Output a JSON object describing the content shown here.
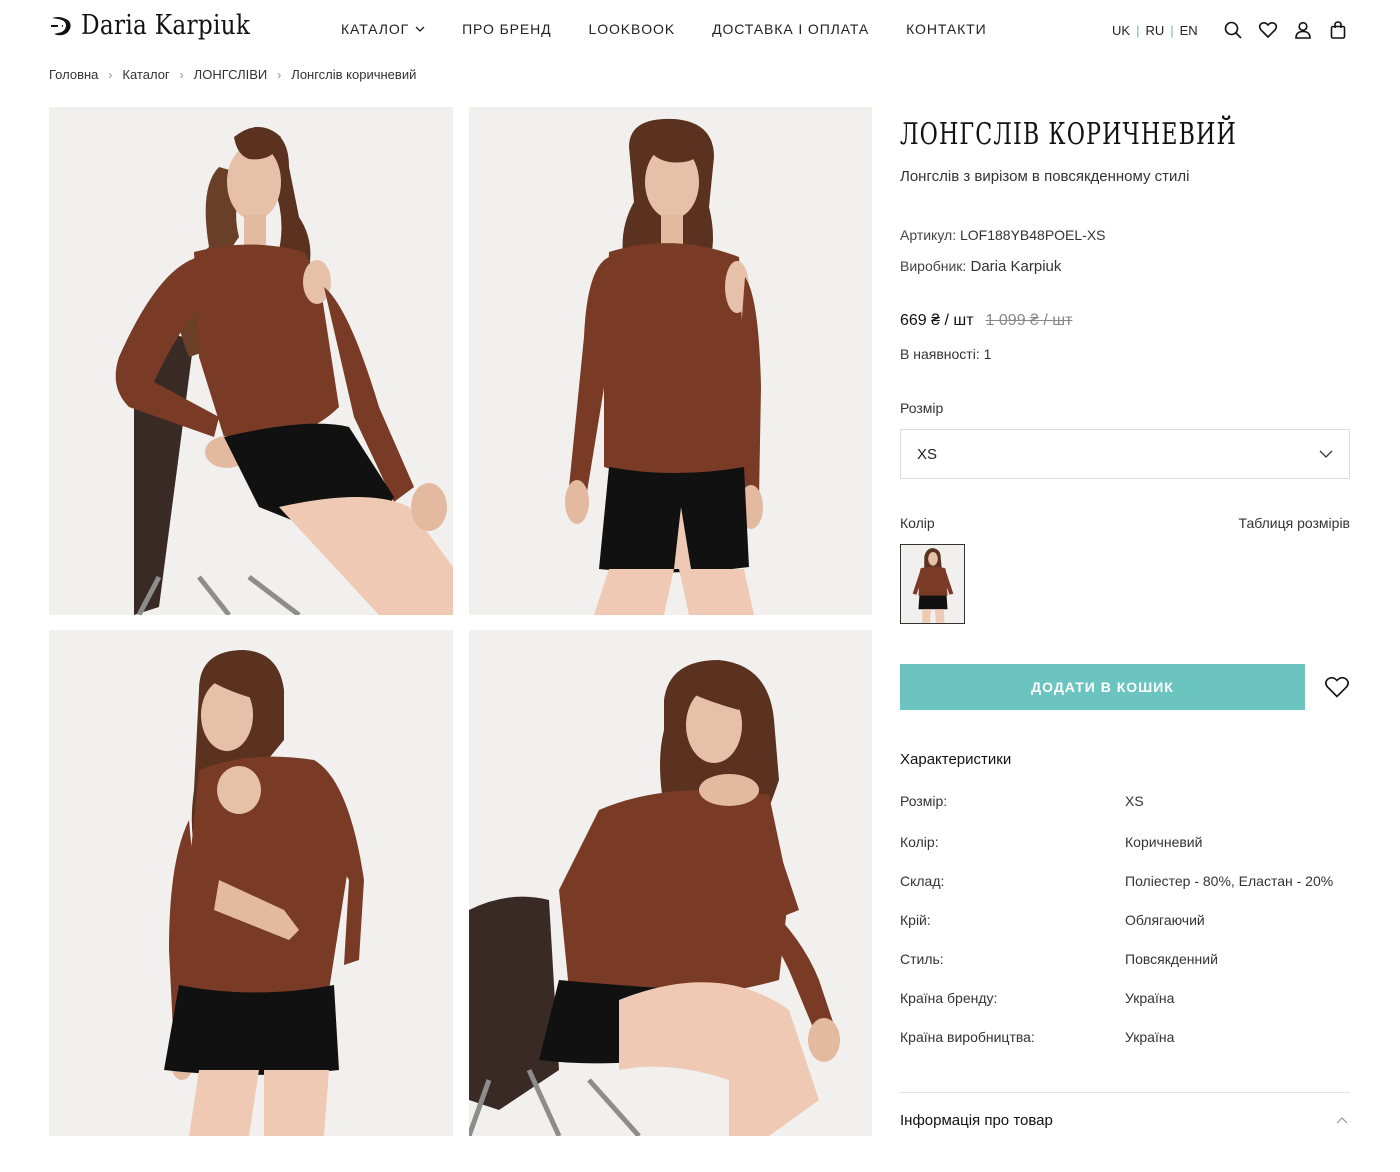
{
  "header": {
    "logo_text": "Daria Karpiuk",
    "nav": [
      "КАТАЛОГ",
      "ПРО БРЕНД",
      "LOOKBOOK",
      "ДОСТАВКА І ОПЛАТА",
      "КОНТАКТИ"
    ],
    "languages": [
      "UK",
      "RU",
      "EN"
    ],
    "icons": [
      "search-icon",
      "heart-icon",
      "user-icon",
      "bag-icon"
    ]
  },
  "breadcrumb": [
    "Головна",
    "Каталог",
    "ЛОНГСЛІВИ",
    "Лонгслів коричневий"
  ],
  "product": {
    "title": "ЛОНГСЛІВ КОРИЧНЕВИЙ",
    "subtitle": "Лонгслів з вирізом в повсякденному стилі",
    "sku_label": "Артикул:",
    "sku": "LOF188YB48POEL-XS",
    "maker_label": "Виробник:",
    "maker": "Daria Karpiuk",
    "price": "669 ₴ / шт",
    "old_price": "1 099 ₴ / шт",
    "stock_label": "В наявності:",
    "stock": "1",
    "size_label": "Розмір",
    "size_selected": "XS",
    "color_label": "Колір",
    "size_table_link": "Таблиця розмірів",
    "add_to_cart": "ДОДАТИ В КОШИК"
  },
  "specs": {
    "title": "Характеристики",
    "rows": [
      {
        "key": "Розмір:",
        "value": "XS"
      },
      {
        "key": "Колір:",
        "value": "Коричневий"
      },
      {
        "key": "Склад:",
        "value": "Поліестер - 80%, Еластан - 20%"
      },
      {
        "key": "Крій:",
        "value": "Облягаючий"
      },
      {
        "key": "Стиль:",
        "value": "Повсякденний"
      },
      {
        "key": "Країна бренду:",
        "value": "Україна"
      },
      {
        "key": "Країна виробництва:",
        "value": "Україна"
      }
    ]
  },
  "accordion": {
    "title": "Інформація про товар"
  },
  "colors": {
    "accent": "#6bc4bf",
    "garment": "#7a3b26",
    "skirt": "#111111",
    "chair": "#3a2a26"
  }
}
